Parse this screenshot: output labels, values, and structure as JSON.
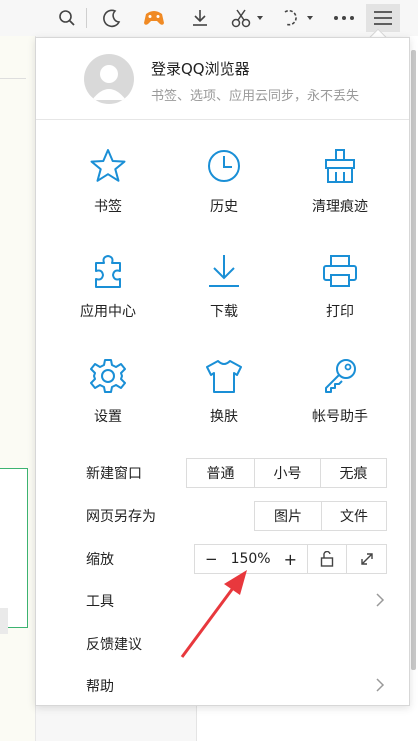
{
  "colors": {
    "accent": "#1a8fd6",
    "gift": "#f08a24",
    "arrow": "#e8383d"
  },
  "toolbar": {
    "icons": [
      "search-icon",
      "night-mode-icon",
      "game-icon",
      "download-icon",
      "screenshot-icon",
      "undo-icon",
      "more-icon",
      "menu-icon"
    ]
  },
  "account": {
    "title": "登录QQ浏览器",
    "subtitle": "书签、选项、应用云同步，永不丢失"
  },
  "grid": [
    {
      "label": "书签",
      "icon": "star-icon"
    },
    {
      "label": "历史",
      "icon": "clock-icon"
    },
    {
      "label": "清理痕迹",
      "icon": "broom-icon"
    },
    {
      "label": "应用中心",
      "icon": "puzzle-icon"
    },
    {
      "label": "下载",
      "icon": "download-icon"
    },
    {
      "label": "打印",
      "icon": "printer-icon"
    },
    {
      "label": "设置",
      "icon": "gear-icon"
    },
    {
      "label": "换肤",
      "icon": "shirt-icon"
    },
    {
      "label": "帐号助手",
      "icon": "key-icon"
    }
  ],
  "rows": {
    "new_window": {
      "label": "新建窗口",
      "options": [
        "普通",
        "小号",
        "无痕"
      ]
    },
    "save_as": {
      "label": "网页另存为",
      "options": [
        "图片",
        "文件"
      ]
    },
    "zoom": {
      "label": "缩放",
      "minus": "−",
      "value": "150%",
      "plus": "+"
    },
    "tools": {
      "label": "工具"
    },
    "feedback": {
      "label": "反馈建议"
    },
    "help": {
      "label": "帮助"
    }
  }
}
